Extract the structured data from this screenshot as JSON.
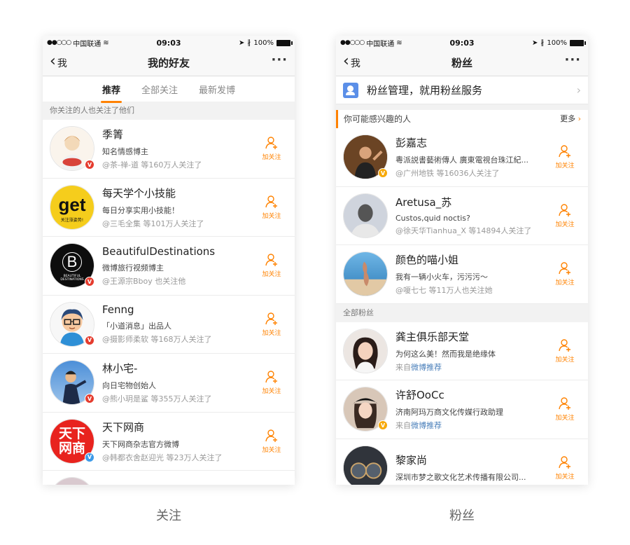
{
  "status": {
    "carrier": "中国联通",
    "time": "09:03",
    "battery": "100%"
  },
  "left": {
    "caption": "关注",
    "back": "我",
    "title": "我的好友",
    "tabs": [
      "推荐",
      "全部关注",
      "最新发博"
    ],
    "section": "你关注的人也关注了他们",
    "follow_label": "加关注",
    "users": [
      {
        "name": "季箐",
        "desc": "知名情感博主",
        "meta": "@茶-禅-道 等160万人关注了",
        "badge": "red"
      },
      {
        "name": "每天学个小技能",
        "desc": "每日分享实用小技能！",
        "meta": "@三毛全集 等101万人关注了",
        "badge": "none",
        "avatar_text": "get",
        "avatar_sub": "关注涨姿势!"
      },
      {
        "name": "BeautifulDestinations",
        "desc": "微博旅行视频博主",
        "meta": "@王源宗Bboy 也关注他",
        "badge": "red",
        "avatar_text": "B",
        "avatar_sub": "BEAUTIFUL DESTINATIONS"
      },
      {
        "name": "Fenng",
        "desc": "「小道消息」出品人",
        "meta": "@摄影师柔软 等168万人关注了",
        "badge": "red"
      },
      {
        "name": "林小宅-",
        "desc": "向日宅物创始人",
        "meta": "@熊小玥是鲨 等355万人关注了",
        "badge": "red"
      },
      {
        "name": "天下网商",
        "desc": "天下网商杂志官方微博",
        "meta": "@韩都衣舍赵迎光 等23万人关注了",
        "badge": "blue",
        "avatar_text": "天下网商"
      }
    ]
  },
  "right": {
    "caption": "粉丝",
    "back": "我",
    "title": "粉丝",
    "manage": "粉丝管理，就用粉丝服务",
    "section_interest": "你可能感兴趣的人",
    "more": "更多",
    "section_all": "全部粉丝",
    "follow_label": "加关注",
    "interest_users": [
      {
        "name": "彭嘉志",
        "desc": "粵派説書藝術傳人 廣東電視台珠江紀...",
        "meta": "@广州地铁 等16036人关注了",
        "badge": "orange"
      },
      {
        "name": "Aretusa_苏",
        "desc": "Custos,quid noctis?",
        "meta": "@徐天华Tianhua_X 等14894人关注了",
        "badge": "none"
      },
      {
        "name": "颜色的喵小姐",
        "desc": "我有一辆小火车，污污污～",
        "meta": "@嗄七七 等11万人也关注她",
        "badge": "none"
      }
    ],
    "fans": [
      {
        "name": "龚主俱乐部天堂",
        "desc": "为何这么美！然而我是绝缘体",
        "meta_prefix": "来自",
        "meta_link": "微博推荐",
        "badge": "none"
      },
      {
        "name": "许舒OoCc",
        "desc": "济南阿玛万商文化传媒行政助理",
        "meta_prefix": "来自",
        "meta_link": "微博推荐",
        "badge": "orange"
      },
      {
        "name": "黎家尚",
        "desc": "深圳市梦之歌文化艺术传播有限公司...",
        "meta_prefix": "",
        "meta_link": "",
        "badge": "none"
      }
    ]
  }
}
